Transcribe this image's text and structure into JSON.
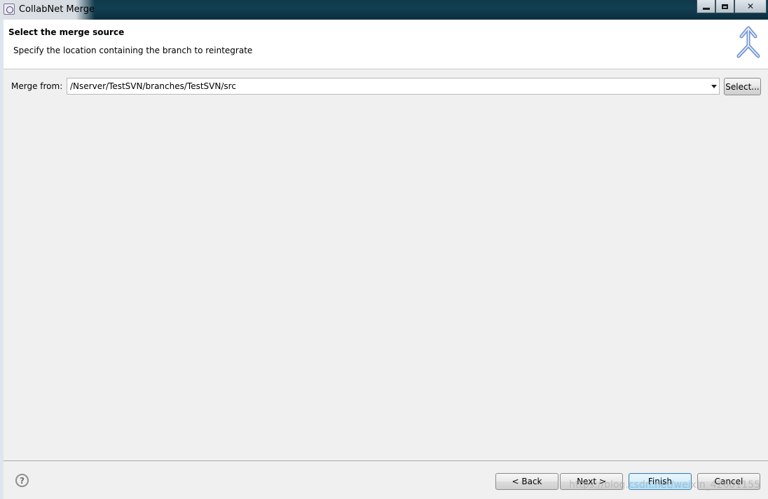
{
  "window": {
    "title": "CollabNet Merge",
    "controls": {
      "minimize": "minimize-icon",
      "maximize": "maximize-icon",
      "close": "✕"
    }
  },
  "header": {
    "title": "Select the merge source",
    "description": "Specify the location containing the branch to reintegrate",
    "icon": "merge-arrows-icon"
  },
  "form": {
    "merge_from_label": "Merge from:",
    "merge_from_value": "/Nserver/TestSVN/branches/TestSVN/src",
    "select_button": "Select..."
  },
  "footer": {
    "help": "?",
    "back": "< Back",
    "next": "Next >",
    "finish": "Finish",
    "cancel": "Cancel",
    "watermark": "https://blog.csdn.net/weixin_42601155"
  },
  "colors": {
    "titlebar": "#123f52",
    "finish_border": "#3c7fb1",
    "wizard_icon": "#4a6fbf"
  }
}
